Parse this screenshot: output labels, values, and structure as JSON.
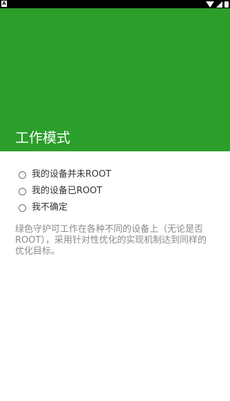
{
  "status_bar": {
    "left_icon_label": "A",
    "icons": [
      "wifi-icon",
      "signal-icon",
      "battery-icon"
    ]
  },
  "header": {
    "title": "工作模式",
    "background_color": "#2b9e2b"
  },
  "options": [
    {
      "label": "我的设备并未ROOT",
      "selected": false
    },
    {
      "label": "我的设备已ROOT",
      "selected": false
    },
    {
      "label": "我不确定",
      "selected": false
    }
  ],
  "description": {
    "lines": [
      "绿色守护可工作在各种不同的设备上（无论是否",
      "ROOT），采用针对性优化的实现机制达到同样的",
      "优化目标。"
    ]
  }
}
